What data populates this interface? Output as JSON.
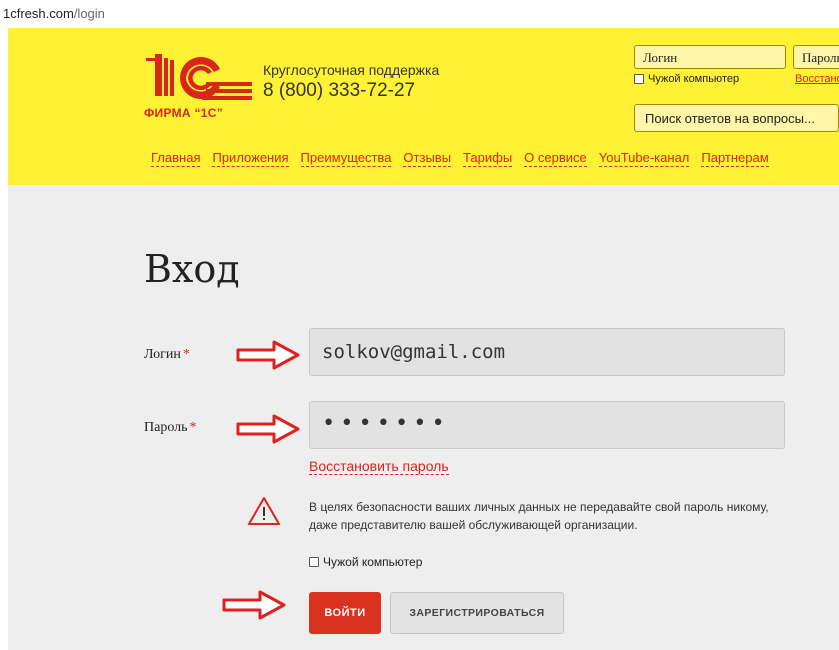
{
  "browser": {
    "url_domain": "1cfresh.com",
    "url_path": "/login"
  },
  "header": {
    "logo_text": "ФИРМА “1С”",
    "support_label": "Круглосуточная поддержка",
    "support_phone": "8 (800) 333-72-27",
    "login_placeholder": "Логин",
    "password_placeholder": "Пароль",
    "foreign_computer": "Чужой компьютер",
    "restore": "Восстановить",
    "search_placeholder": "Поиск ответов на вопросы...",
    "nav": [
      "Главная",
      "Приложения",
      "Преимущества",
      "Отзывы",
      "Тарифы",
      "О сервисе",
      "YouTube-канал",
      "Партнерам"
    ]
  },
  "form": {
    "title": "Вход",
    "login_label": "Логин",
    "password_label": "Пароль",
    "required_mark": "*",
    "login_value": "solkov@gmail.com",
    "password_value": "•••••••",
    "restore_link": "Восстановить пароль",
    "warning": "В целях безопасности ваших личных данных не передавайте свой пароль никому, даже представителю вашей обслуживающей организации.",
    "foreign_computer": "Чужой компьютер",
    "submit": "ВОЙТИ",
    "register": "ЗАРЕГИСТРИРОВАТЬСЯ"
  },
  "colors": {
    "brand_yellow": "#fff133",
    "brand_red": "#d7261c",
    "arrow_red": "#e02020"
  },
  "icons": [
    "logo-1c-icon",
    "warning-icon",
    "arrow-right-icon"
  ]
}
